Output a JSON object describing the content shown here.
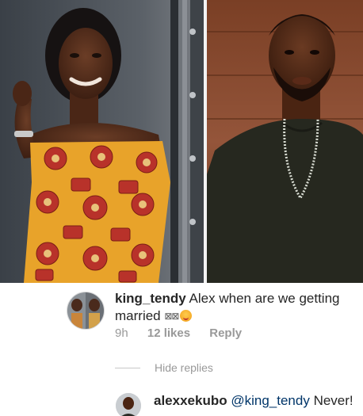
{
  "comment": {
    "username": "king_tendy",
    "text": "Alex when are we getting married",
    "emoji_boxes": "⊠⊠",
    "time": "9h",
    "likes": "12 likes",
    "reply_label": "Reply"
  },
  "thread": {
    "hide_replies_label": "Hide replies"
  },
  "reply": {
    "username": "alexxekubo",
    "mention": "@king_tendy",
    "text": "Never!"
  },
  "colors": {
    "text": "#262626",
    "muted": "#999999",
    "mention": "#003569",
    "dress_orange": "#e8a32a",
    "dress_red": "#b8322a",
    "shirt": "#26281f",
    "wood_background": "#8a4a2c"
  },
  "icons": {
    "comment_emoji": "blushing-face-icon"
  }
}
